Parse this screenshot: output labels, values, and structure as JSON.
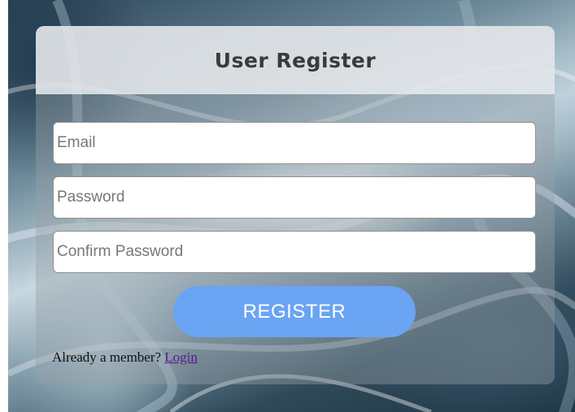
{
  "form": {
    "title": "User Register",
    "fields": [
      {
        "placeholder": "Email",
        "value": ""
      },
      {
        "placeholder": "Password",
        "value": ""
      },
      {
        "placeholder": "Confirm Password",
        "value": ""
      }
    ],
    "submit_label": "REGISTER",
    "footer_text": "Already a member? ",
    "login_link": "Login"
  },
  "colors": {
    "button": "#6aa4f3",
    "link": "#551a8b"
  }
}
